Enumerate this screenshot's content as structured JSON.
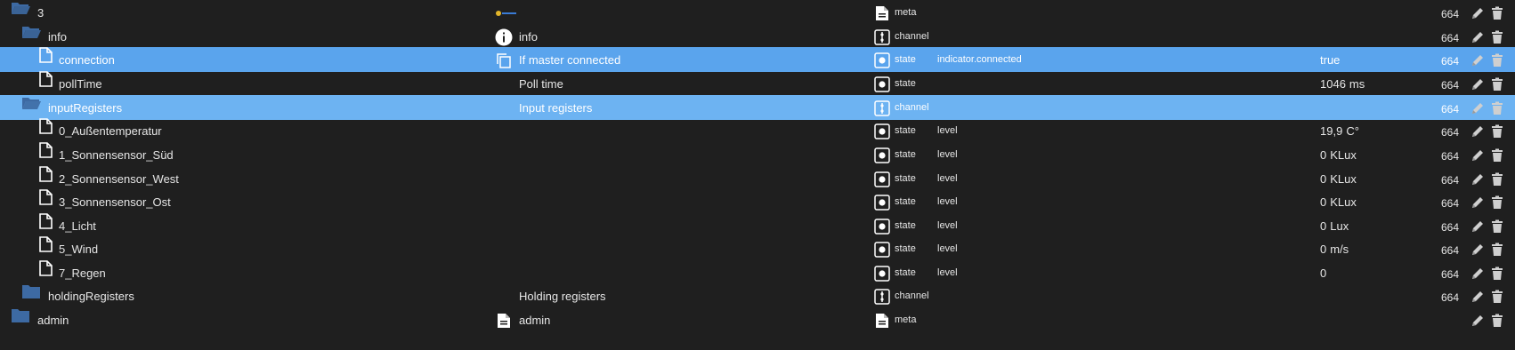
{
  "rows": [
    {
      "id": "3",
      "label": "3",
      "depth": 0,
      "kind": "folder-open",
      "name_icon": "logo",
      "name": "",
      "role": "",
      "type": "meta",
      "type_icon": "file-text-icon",
      "value": "",
      "unit": "",
      "acl": "664",
      "selected": ""
    },
    {
      "id": "info",
      "label": "info",
      "depth": 1,
      "kind": "folder-open",
      "name_icon": "info-icon",
      "name": "info",
      "role": "",
      "type": "channel",
      "type_icon": "channel-icon",
      "value": "",
      "unit": "",
      "acl": "664",
      "selected": ""
    },
    {
      "id": "connection",
      "label": "connection",
      "depth": 2,
      "kind": "file",
      "name_icon": "copy-icon",
      "name": "If master connected",
      "role": "indicator.connected",
      "type": "state",
      "type_icon": "state-icon",
      "value": "true",
      "unit": "",
      "acl": "664",
      "selected": "sel"
    },
    {
      "id": "pollTime",
      "label": "pollTime",
      "depth": 2,
      "kind": "file",
      "name_icon": "",
      "name": "Poll time",
      "role": "",
      "type": "state",
      "type_icon": "state-icon",
      "value": "1046",
      "unit": "ms",
      "acl": "664",
      "selected": ""
    },
    {
      "id": "inputRegisters",
      "label": "inputRegisters",
      "depth": 1,
      "kind": "folder-open",
      "name_icon": "",
      "name": "Input registers",
      "role": "",
      "type": "channel",
      "type_icon": "channel-icon",
      "value": "",
      "unit": "",
      "acl": "664",
      "selected": "sel2"
    },
    {
      "id": "r0",
      "label": "0_Außentemperatur",
      "depth": 2,
      "kind": "file",
      "name_icon": "",
      "name": "",
      "role": "level",
      "type": "state",
      "type_icon": "state-icon",
      "value": "19,9",
      "unit": "C°",
      "acl": "664",
      "selected": ""
    },
    {
      "id": "r1",
      "label": "1_Sonnensensor_Süd",
      "depth": 2,
      "kind": "file",
      "name_icon": "",
      "name": "",
      "role": "level",
      "type": "state",
      "type_icon": "state-icon",
      "value": "0",
      "unit": "KLux",
      "acl": "664",
      "selected": ""
    },
    {
      "id": "r2",
      "label": "2_Sonnensensor_West",
      "depth": 2,
      "kind": "file",
      "name_icon": "",
      "name": "",
      "role": "level",
      "type": "state",
      "type_icon": "state-icon",
      "value": "0",
      "unit": "KLux",
      "acl": "664",
      "selected": ""
    },
    {
      "id": "r3",
      "label": "3_Sonnensensor_Ost",
      "depth": 2,
      "kind": "file",
      "name_icon": "",
      "name": "",
      "role": "level",
      "type": "state",
      "type_icon": "state-icon",
      "value": "0",
      "unit": "KLux",
      "acl": "664",
      "selected": ""
    },
    {
      "id": "r4",
      "label": "4_Licht",
      "depth": 2,
      "kind": "file",
      "name_icon": "",
      "name": "",
      "role": "level",
      "type": "state",
      "type_icon": "state-icon",
      "value": "0",
      "unit": "Lux",
      "acl": "664",
      "selected": ""
    },
    {
      "id": "r5",
      "label": "5_Wind",
      "depth": 2,
      "kind": "file",
      "name_icon": "",
      "name": "",
      "role": "level",
      "type": "state",
      "type_icon": "state-icon",
      "value": "0",
      "unit": "m/s",
      "acl": "664",
      "selected": ""
    },
    {
      "id": "r7",
      "label": "7_Regen",
      "depth": 2,
      "kind": "file",
      "name_icon": "",
      "name": "",
      "role": "level",
      "type": "state",
      "type_icon": "state-icon",
      "value": "0",
      "unit": "",
      "acl": "664",
      "selected": ""
    },
    {
      "id": "holdingRegisters",
      "label": "holdingRegisters",
      "depth": 1,
      "kind": "folder-closed",
      "name_icon": "",
      "name": "Holding registers",
      "role": "",
      "type": "channel",
      "type_icon": "channel-icon",
      "value": "",
      "unit": "",
      "acl": "664",
      "selected": ""
    },
    {
      "id": "admin",
      "label": "admin",
      "depth": 0,
      "kind": "folder-closed",
      "name_icon": "file-text-icon",
      "name": "admin",
      "role": "",
      "type": "meta",
      "type_icon": "file-text-icon",
      "value": "",
      "unit": "",
      "acl": "",
      "selected": ""
    }
  ],
  "colors": {
    "folder": "#3d6aa3",
    "selected": "#5aa4ed",
    "selected_light": "#6db3f2",
    "background": "#1f1f1f"
  },
  "actions": {
    "edit": "pencil-icon",
    "delete": "trash-icon"
  }
}
